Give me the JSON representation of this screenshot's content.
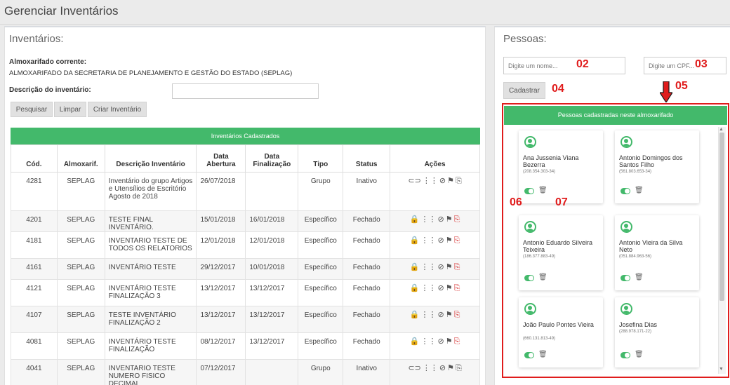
{
  "page": {
    "title": "Gerenciar Inventários"
  },
  "inventarios": {
    "title": "Inventários:",
    "almox_label": "Almoxarifado corrente:",
    "almox_value": "ALMOXARIFADO DA SECRETARIA DE PLANEJAMENTO E GESTÃO DO ESTADO (SEPLAG)",
    "desc_label": "Descrição do inventário:",
    "desc_value": "",
    "buttons": {
      "search": "Pesquisar",
      "clear": "Limpar",
      "create": "Criar Inventário"
    },
    "table_title": "Inventários Cadastrados",
    "columns": [
      "Cód.",
      "Almoxarif.",
      "Descrição Inventário",
      "Data Abertura",
      "Data Finalização",
      "Tipo",
      "Status",
      "Ações"
    ],
    "rows": [
      {
        "cod": "4281",
        "almox": "SEPLAG",
        "desc": "Inventário do grupo Artigos e Utensílios de Escritório Agosto de 2018",
        "abertura": "26/07/2018",
        "finalizacao": "",
        "tipo": "Grupo",
        "status": "Inativo"
      },
      {
        "cod": "4201",
        "almox": "SEPLAG",
        "desc": "TESTE FINAL INVENTÁRIO.",
        "abertura": "15/01/2018",
        "finalizacao": "16/01/2018",
        "tipo": "Específico",
        "status": "Fechado"
      },
      {
        "cod": "4181",
        "almox": "SEPLAG",
        "desc": "INVENTARIO TESTE DE TODOS OS RELATORIOS",
        "abertura": "12/01/2018",
        "finalizacao": "12/01/2018",
        "tipo": "Específico",
        "status": "Fechado"
      },
      {
        "cod": "4161",
        "almox": "SEPLAG",
        "desc": "INVENTÁRIO TESTE",
        "abertura": "29/12/2017",
        "finalizacao": "10/01/2018",
        "tipo": "Específico",
        "status": "Fechado"
      },
      {
        "cod": "4121",
        "almox": "SEPLAG",
        "desc": "INVENTÁRIO TESTE FINALIZAÇÃO 3",
        "abertura": "13/12/2017",
        "finalizacao": "13/12/2017",
        "tipo": "Específico",
        "status": "Fechado"
      },
      {
        "cod": "4107",
        "almox": "SEPLAG",
        "desc": "TESTE INVENTÁRIO FINALIZAÇÃO 2",
        "abertura": "13/12/2017",
        "finalizacao": "13/12/2017",
        "tipo": "Específico",
        "status": "Fechado"
      },
      {
        "cod": "4081",
        "almox": "SEPLAG",
        "desc": "INVENTÁRIO TESTE FINALIZAÇÃO",
        "abertura": "08/12/2017",
        "finalizacao": "13/12/2017",
        "tipo": "Específico",
        "status": "Fechado"
      },
      {
        "cod": "4041",
        "almox": "SEPLAG",
        "desc": "INVENTARIO TESTE NUMERO FISICO DECIMAL",
        "abertura": "07/12/2017",
        "finalizacao": "",
        "tipo": "Grupo",
        "status": "Inativo"
      }
    ]
  },
  "pessoas": {
    "title": "Pessoas:",
    "name_placeholder": "Digite um nome...",
    "cpf_placeholder": "Digite um CPF...",
    "register_button": "Cadastrar",
    "list_title": "Pessoas cadastradas neste almoxarifado",
    "people": [
      {
        "name": "Ana Jussenia Viana Bezerra",
        "cpf": "(208.354.303-34)"
      },
      {
        "name": "Antonio Domingos dos Santos Filho",
        "cpf": "(561.803.653-34)"
      },
      {
        "name": "Antonio Eduardo Silveira Teixeira",
        "cpf": "(186.377.883-49)"
      },
      {
        "name": "Antonio Vieira da Silva Neto",
        "cpf": "(051.884.963-56)"
      },
      {
        "name": "João Paulo Pontes Vieira",
        "cpf": "(660.131.813-49)"
      },
      {
        "name": "Josefina Dias",
        "cpf": "(288.978.171-22)"
      }
    ]
  },
  "annotations": {
    "a02": "02",
    "a03": "03",
    "a04": "04",
    "a05": "05",
    "a06": "06",
    "a07": "07"
  },
  "colors": {
    "accent": "#43b96b",
    "annotation": "#e01c1c"
  }
}
